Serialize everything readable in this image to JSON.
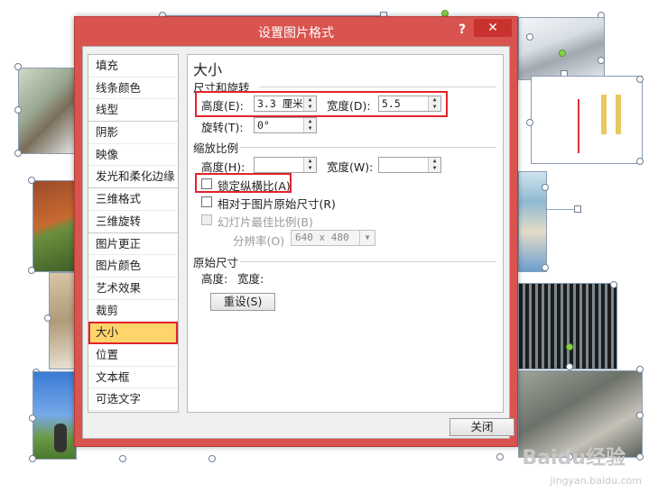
{
  "dialog": {
    "title": "设置图片格式",
    "help": "?",
    "close_x": "✕",
    "close_button": "关闭"
  },
  "nav": {
    "items": [
      {
        "label": "填充"
      },
      {
        "label": "线条颜色"
      },
      {
        "label": "线型"
      },
      {
        "label": "阴影"
      },
      {
        "label": "映像"
      },
      {
        "label": "发光和柔化边缘"
      },
      {
        "label": "三维格式"
      },
      {
        "label": "三维旋转"
      },
      {
        "label": "图片更正"
      },
      {
        "label": "图片颜色"
      },
      {
        "label": "艺术效果"
      },
      {
        "label": "裁剪"
      },
      {
        "label": "大小",
        "active": true
      },
      {
        "label": "位置"
      },
      {
        "label": "文本框"
      },
      {
        "label": "可选文字"
      }
    ]
  },
  "size_panel": {
    "heading": "大小",
    "size_rotate": {
      "group": "尺寸和旋转",
      "height_label": "高度(E):",
      "height_value": "3.3 厘米",
      "width_label": "宽度(D):",
      "width_value": "5.5",
      "rotate_label": "旋转(T):",
      "rotate_value": "0°"
    },
    "scale": {
      "group": "缩放比例",
      "height_label": "高度(H):",
      "height_value": "",
      "width_label": "宽度(W):",
      "width_value": "",
      "lock_aspect": "锁定纵横比(A)",
      "lock_aspect_checked": false,
      "relative_original": "相对于图片原始尺寸(R)",
      "relative_original_checked": false,
      "best_scale": "幻灯片最佳比例(B)",
      "resolution_label": "分辨率(O)",
      "resolution_value": "640 x 480"
    },
    "original": {
      "group": "原始尺寸",
      "height_label": "高度:",
      "width_label": "宽度:",
      "reset_button": "重设(S)"
    }
  },
  "watermark": {
    "main": "Baidu经验",
    "sub": "jingyan.baidu.com"
  }
}
